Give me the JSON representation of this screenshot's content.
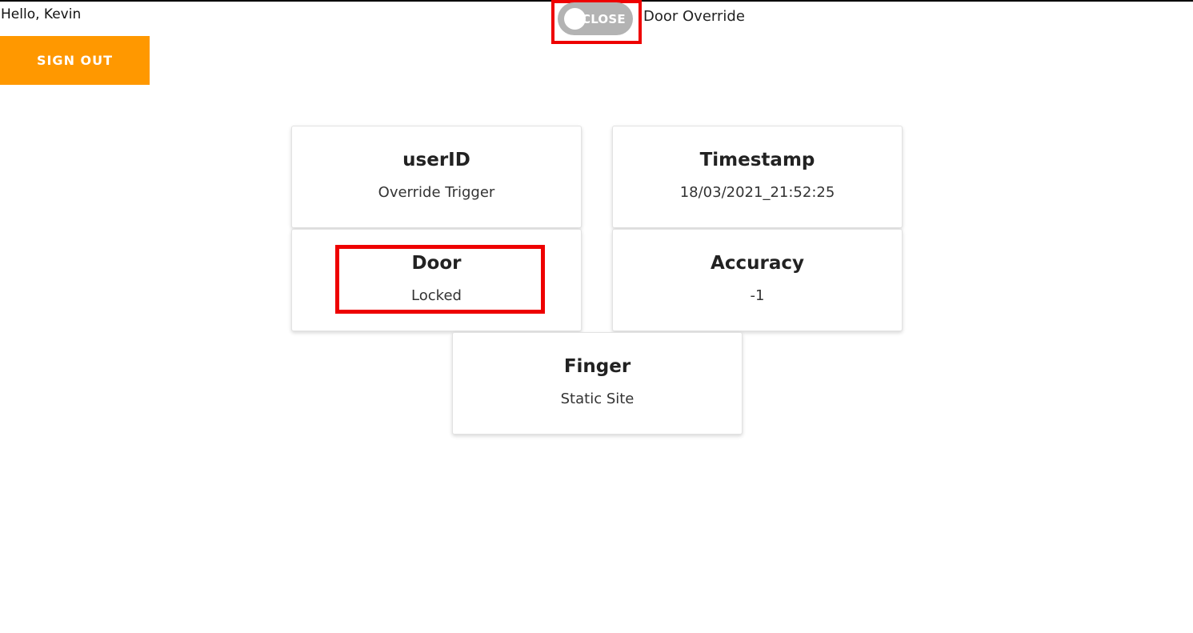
{
  "header": {
    "greeting": "Hello, Kevin",
    "sign_out_label": "SIGN OUT",
    "toggle_state_text": "CLOSE",
    "override_label": "Door Override"
  },
  "colors": {
    "sign_out_bg": "#ff9800",
    "toggle_off": "#b3b3b3",
    "highlight": "#ee0000"
  },
  "cards": {
    "userid": {
      "title": "userID",
      "value": "Override Trigger"
    },
    "timestamp": {
      "title": "Timestamp",
      "value": "18/03/2021_21:52:25"
    },
    "door": {
      "title": "Door",
      "value": "Locked"
    },
    "accuracy": {
      "title": "Accuracy",
      "value": "-1"
    },
    "finger": {
      "title": "Finger",
      "value": "Static Site"
    }
  }
}
